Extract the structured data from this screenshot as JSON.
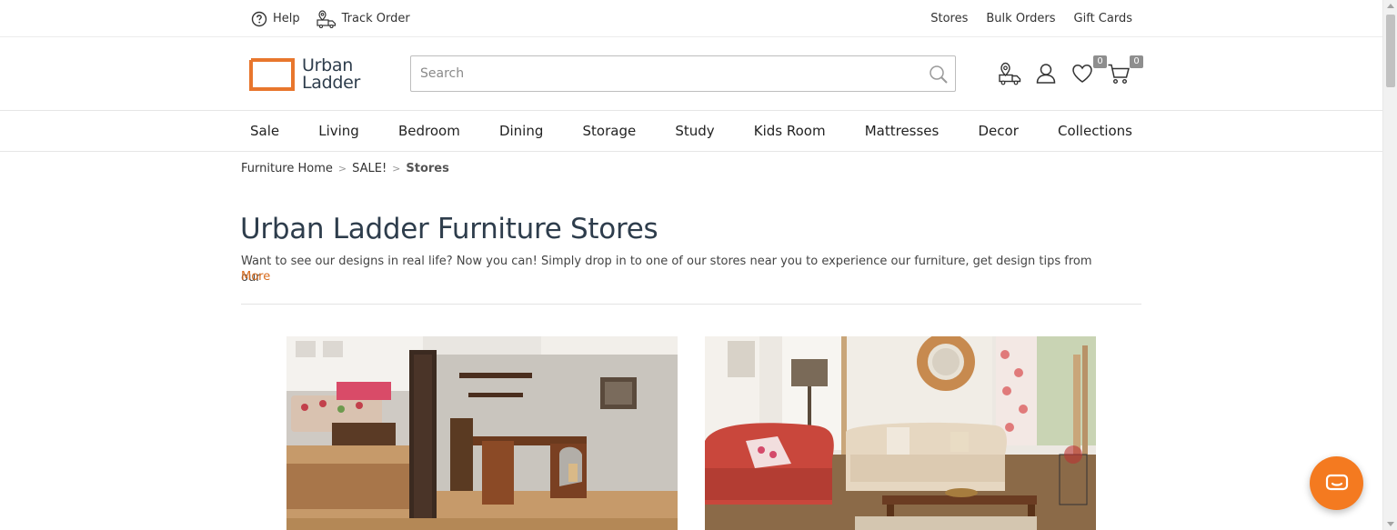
{
  "topbar": {
    "help_label": "Help",
    "track_order_label": "Track Order",
    "links": [
      "Stores",
      "Bulk Orders",
      "Gift Cards"
    ]
  },
  "brand": {
    "name_line1": "Urban",
    "name_line2": "Ladder",
    "accent_color": "#e8762d"
  },
  "search": {
    "placeholder": "Search"
  },
  "header_icons": {
    "wishlist_count": "0",
    "cart_count": "0"
  },
  "nav": {
    "items": [
      "Sale",
      "Living",
      "Bedroom",
      "Dining",
      "Storage",
      "Study",
      "Kids Room",
      "Mattresses",
      "Decor",
      "Collections"
    ]
  },
  "breadcrumb": {
    "items": [
      "Furniture Home",
      "SALE!"
    ],
    "current": "Stores"
  },
  "main": {
    "title": "Urban Ladder Furniture Stores",
    "description": "Want to see our designs in real life? Now you can! Simply drop in to one of our stores near you to experience our furniture, get design tips from our",
    "more_label": "More"
  },
  "colors": {
    "link_orange": "#d96c1e",
    "chat_orange": "#f47a20",
    "title_navy": "#2e3d4c"
  }
}
